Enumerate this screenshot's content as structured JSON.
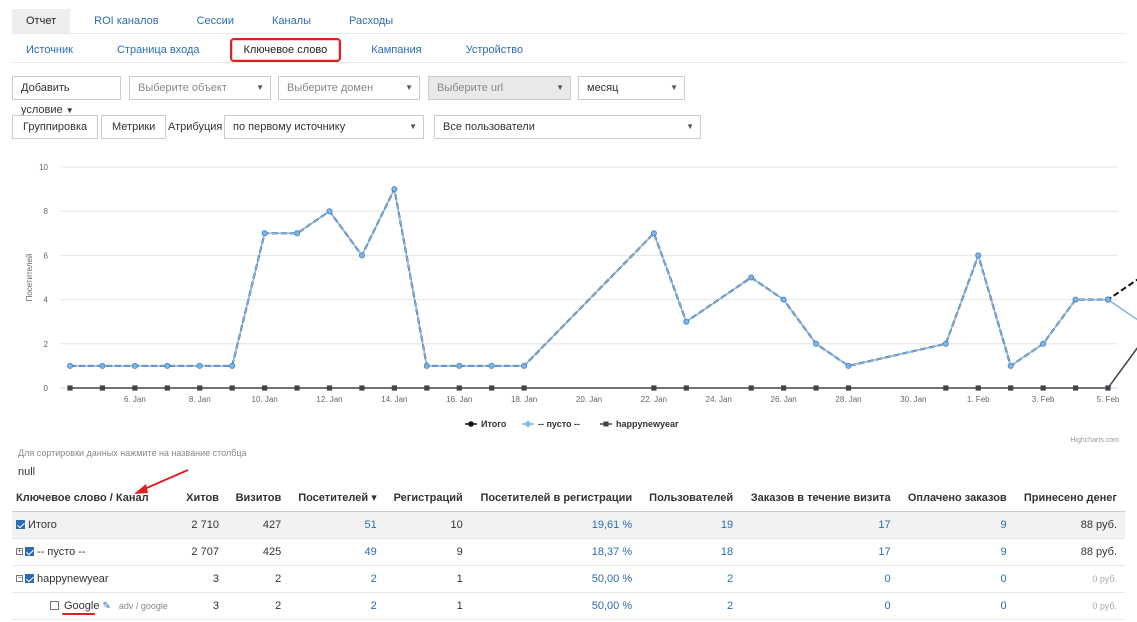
{
  "tabs_top": [
    {
      "label": "Отчет",
      "active": true
    },
    {
      "label": "ROI каналов",
      "active": false
    },
    {
      "label": "Сессии",
      "active": false
    },
    {
      "label": "Каналы",
      "active": false
    },
    {
      "label": "Расходы",
      "active": false
    }
  ],
  "tabs_sub": [
    {
      "label": "Источник",
      "active": false
    },
    {
      "label": "Страница входа",
      "active": false
    },
    {
      "label": "Ключевое слово",
      "active": true
    },
    {
      "label": "Кампания",
      "active": false
    },
    {
      "label": "Устройство",
      "active": false
    }
  ],
  "filters": {
    "add_condition": "Добавить условие",
    "object_placeholder": "Выберите объект",
    "domain_placeholder": "Выберите домен",
    "url_placeholder": "Выберите url",
    "period": "месяц"
  },
  "controls": {
    "grouping": "Группировка",
    "metrics": "Метрики",
    "attribution_label": "Атрибуция",
    "attribution_value": "по первому источнику",
    "users_value": "Все пользователи"
  },
  "chart_data": {
    "type": "line",
    "ylabel": "Посетителей",
    "ylim": [
      0,
      10
    ],
    "yticks": [
      0,
      2,
      4,
      6,
      8,
      10
    ],
    "x": [
      "4. Jan",
      "5. Jan",
      "6. Jan",
      "7. Jan",
      "8. Jan",
      "9. Jan",
      "10. Jan",
      "11. Jan",
      "12. Jan",
      "13. Jan",
      "14. Jan",
      "15. Jan",
      "16. Jan",
      "17. Jan",
      "18. Jan",
      "19. Jan",
      "20. Jan",
      "21. Jan",
      "22. Jan",
      "23. Jan",
      "24. Jan",
      "25. Jan",
      "26. Jan",
      "27. Jan",
      "28. Jan",
      "29. Jan",
      "30. Jan",
      "31. Jan",
      "1. Feb",
      "2. Feb",
      "3. Feb",
      "4. Feb",
      "5. Feb"
    ],
    "xtick_labels": [
      "6. Jan",
      "8. Jan",
      "10. Jan",
      "12. Jan",
      "14. Jan",
      "16. Jan",
      "18. Jan",
      "20. Jan",
      "22. Jan",
      "24. Jan",
      "26. Jan",
      "28. Jan",
      "30. Jan",
      "1. Feb",
      "3. Feb",
      "5. Feb"
    ],
    "series": [
      {
        "name": "Итого",
        "color": "#111111",
        "marker": "circle",
        "values": [
          1,
          1,
          1,
          1,
          1,
          1,
          7,
          7,
          8,
          6,
          9,
          1,
          1,
          1,
          1,
          null,
          null,
          null,
          7,
          3,
          null,
          5,
          4,
          2,
          1,
          null,
          null,
          2,
          6,
          1,
          2,
          4,
          4,
          5
        ]
      },
      {
        "name": "-- пусто --",
        "color": "#7cb5ec",
        "marker": "diamond",
        "values": [
          1,
          1,
          1,
          1,
          1,
          1,
          7,
          7,
          8,
          6,
          9,
          1,
          1,
          1,
          1,
          null,
          null,
          null,
          7,
          3,
          null,
          5,
          4,
          2,
          1,
          null,
          null,
          2,
          6,
          1,
          2,
          4,
          4,
          3
        ]
      },
      {
        "name": "happynewyear",
        "color": "#434348",
        "marker": "square",
        "values": [
          0,
          0,
          0,
          0,
          0,
          0,
          0,
          0,
          0,
          0,
          0,
          0,
          0,
          0,
          0,
          null,
          null,
          null,
          0,
          0,
          null,
          0,
          0,
          0,
          0,
          null,
          null,
          0,
          0,
          0,
          0,
          0,
          0,
          2
        ]
      }
    ],
    "credit": "Highcharts.com",
    "legend": "bottom-center"
  },
  "sort_hint": "Для сортировки данных нажмите на название столбца",
  "null_text": "null",
  "table": {
    "headers": [
      "Ключевое слово / Канал",
      "Хитов",
      "Визитов",
      "Посетителей ▾",
      "Регистраций",
      "Посетителей в регистрации",
      "Пользователей",
      "Заказов в течение визита",
      "Оплачено заказов",
      "Принесено денег"
    ],
    "rows": [
      {
        "name": "Итого",
        "toggle": "",
        "checked": true,
        "indent": 0,
        "cells": [
          "2 710",
          "427",
          "51",
          "10",
          "19,61 %",
          "19",
          "17",
          "9",
          "88 руб."
        ],
        "total": true
      },
      {
        "name": "-- пусто --",
        "toggle": "⊞",
        "checked": true,
        "indent": 0,
        "cells": [
          "2 707",
          "425",
          "49",
          "9",
          "18,37 %",
          "18",
          "17",
          "9",
          "88 руб."
        ]
      },
      {
        "name": "happynewyear",
        "toggle": "⊟",
        "checked": true,
        "indent": 0,
        "cells": [
          "3",
          "2",
          "2",
          "1",
          "50,00 %",
          "2",
          "0",
          "0",
          "0 руб."
        ]
      },
      {
        "name": "Google",
        "sub": "adv / google",
        "toggle": "",
        "checked": false,
        "indent": 1,
        "cells": [
          "3",
          "2",
          "2",
          "1",
          "50,00 %",
          "2",
          "0",
          "0",
          "0 руб."
        ]
      }
    ]
  }
}
